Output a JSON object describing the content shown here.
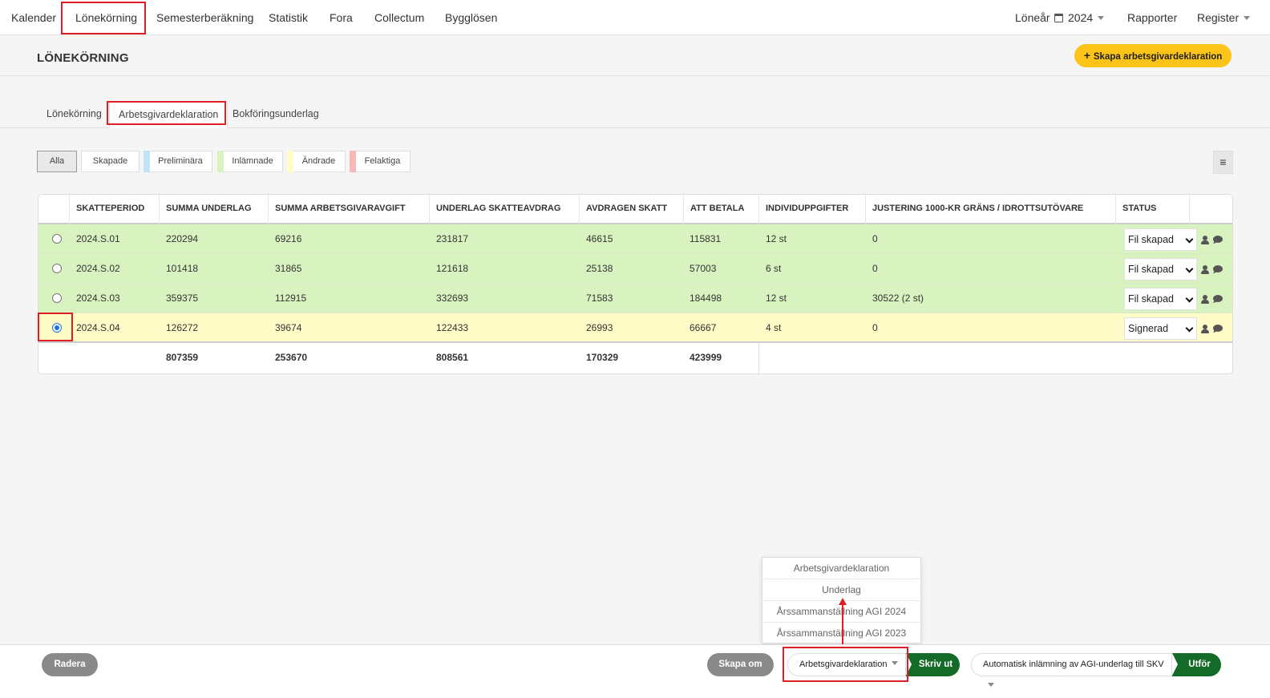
{
  "nav": {
    "items": [
      "Kalender",
      "Lönekörning",
      "Semesterberäkning",
      "Statistik",
      "Fora",
      "Collectum",
      "Bygglösen"
    ],
    "active": "Lönekörning",
    "year_label": "Löneår",
    "year_value": "2024",
    "reports": "Rapporter",
    "register": "Register"
  },
  "header": {
    "title": "LÖNEKÖRNING",
    "create_button": "Skapa arbetsgivardeklaration"
  },
  "subtabs": {
    "items": [
      "Lönekörning",
      "Arbetsgivardeklaration",
      "Bokföringsunderlag"
    ],
    "active": "Arbetsgivardeklaration"
  },
  "filters": {
    "items": [
      {
        "label": "Alla",
        "color": ""
      },
      {
        "label": "Skapade",
        "color": ""
      },
      {
        "label": "Preliminära",
        "color": "#bfe3f7"
      },
      {
        "label": "Inlämnade",
        "color": "#d8f3c0"
      },
      {
        "label": "Ändrade",
        "color": "#fffcc8"
      },
      {
        "label": "Felaktiga",
        "color": "#f6b9b9"
      }
    ],
    "menu_icon": "hamburger-icon"
  },
  "table": {
    "headers": [
      "SKATTEPERIOD",
      "SUMMA UNDERLAG",
      "SUMMA ARBETSGIVARAVGIFT",
      "UNDERLAG SKATTEAVDRAG",
      "AVDRAGEN SKATT",
      "ATT BETALA",
      "INDIVIDUPPGIFTER",
      "JUSTERING 1000-KR GRÄNS / IDROTTSUTÖVARE",
      "STATUS"
    ],
    "rows": [
      {
        "period": "2024.S.01",
        "underlag": "220294",
        "avgift": "69216",
        "skatteavdrag": "231817",
        "avdragen": "46615",
        "betala": "115831",
        "individ": "12 st",
        "justering": "0",
        "status": "Fil skapad",
        "selected": false
      },
      {
        "period": "2024.S.02",
        "underlag": "101418",
        "avgift": "31865",
        "skatteavdrag": "121618",
        "avdragen": "25138",
        "betala": "57003",
        "individ": "6 st",
        "justering": "0",
        "status": "Fil skapad",
        "selected": false
      },
      {
        "period": "2024.S.03",
        "underlag": "359375",
        "avgift": "112915",
        "skatteavdrag": "332693",
        "avdragen": "71583",
        "betala": "184498",
        "individ": "12 st",
        "justering": "30522 (2 st)",
        "status": "Fil skapad",
        "selected": false
      },
      {
        "period": "2024.S.04",
        "underlag": "126272",
        "avgift": "39674",
        "skatteavdrag": "122433",
        "avdragen": "26993",
        "betala": "66667",
        "individ": "4 st",
        "justering": "0",
        "status": "Signerad",
        "selected": true
      }
    ],
    "totals": {
      "underlag": "807359",
      "avgift": "253670",
      "skatteavdrag": "808561",
      "avdragen": "170329",
      "betala": "423999"
    }
  },
  "dropdown": {
    "items": [
      "Arbetsgivardeklaration",
      "Underlag",
      "Årssammanställning AGI 2024",
      "Årssammanställning AGI 2023"
    ]
  },
  "footer": {
    "delete": "Radera",
    "recreate": "Skapa om",
    "print_select": "Arbetsgivardeklaration",
    "print": "Skriv ut",
    "auto_select": "Automatisk inlämning av AGI-underlag till SKV",
    "execute": "Utför"
  },
  "colors": {
    "accent_yellow": "#fcc419",
    "action_green": "#146b27",
    "row_green": "#d8f3c0",
    "row_yellow": "#fffcc8",
    "highlight_red": "#dd1f26"
  }
}
